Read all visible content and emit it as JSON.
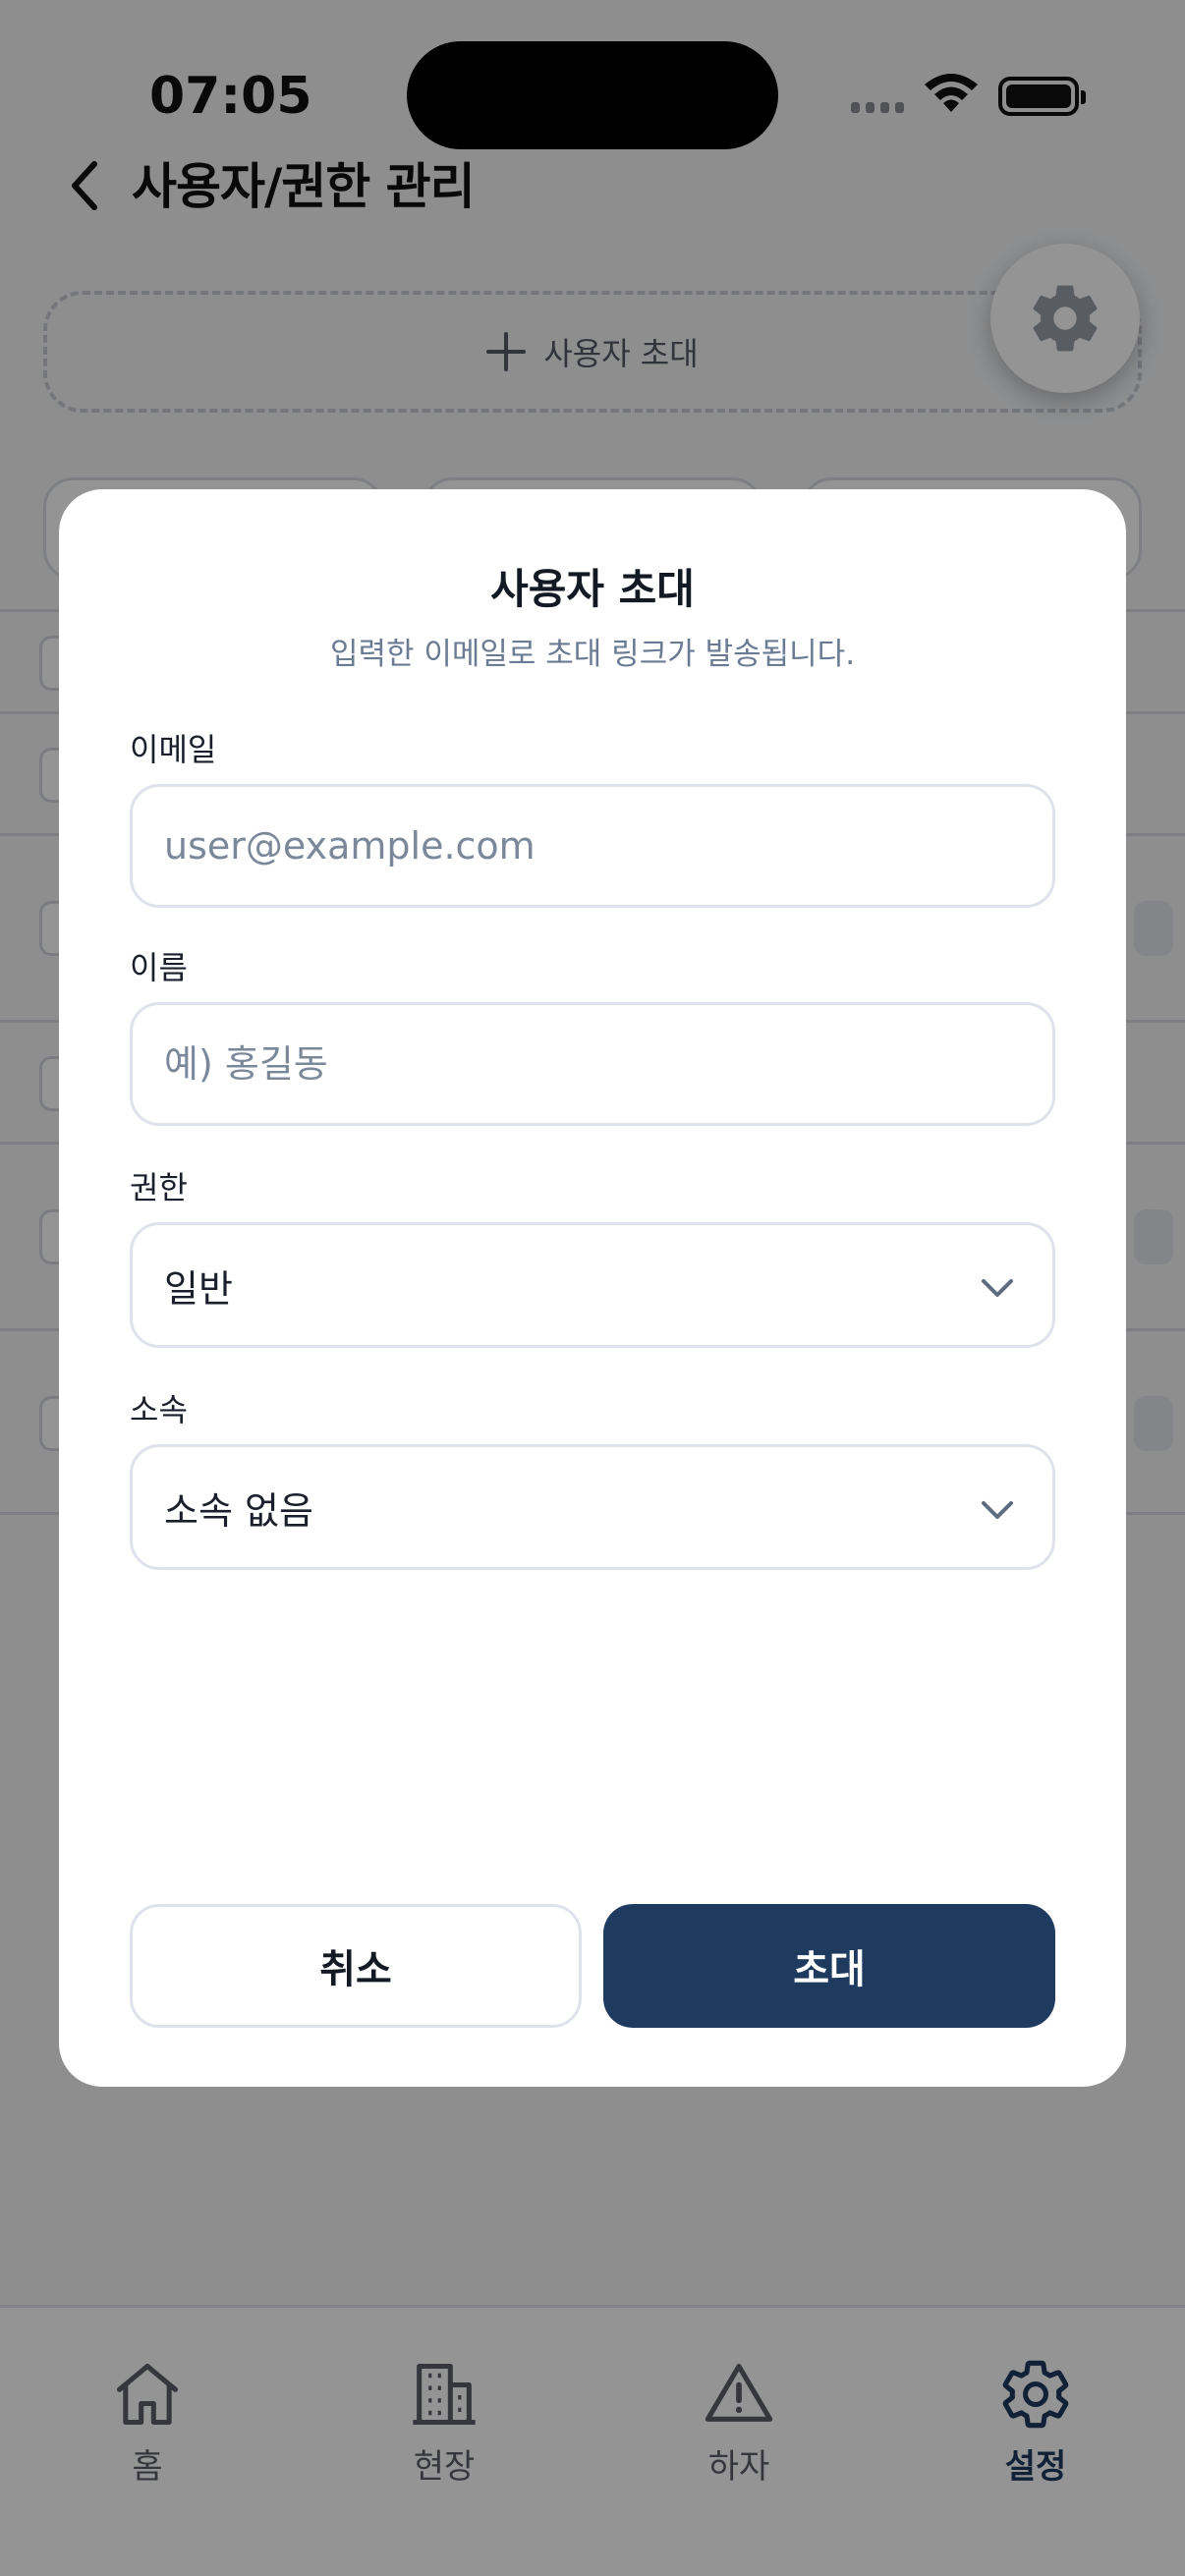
{
  "status_bar": {
    "time": "07:05"
  },
  "header": {
    "title": "사용자/권한 관리"
  },
  "invite_area": {
    "label": "사용자 초대"
  },
  "modal": {
    "title": "사용자 초대",
    "subtitle": "입력한 이메일로 초대 링크가 발송됩니다.",
    "email": {
      "label": "이메일",
      "placeholder": "user@example.com",
      "value": ""
    },
    "name": {
      "label": "이름",
      "placeholder": "예) 홍길동",
      "value": ""
    },
    "role": {
      "label": "권한",
      "selected": "일반"
    },
    "affiliation": {
      "label": "소속",
      "selected": "소속 없음"
    },
    "cancel_label": "취소",
    "invite_label": "초대"
  },
  "tabbar": {
    "items": [
      {
        "label": "홈",
        "icon": "home-icon",
        "active": false
      },
      {
        "label": "현장",
        "icon": "building-icon",
        "active": false
      },
      {
        "label": "하자",
        "icon": "warning-icon",
        "active": false
      },
      {
        "label": "설정",
        "icon": "gear-icon",
        "active": true
      }
    ]
  },
  "colors": {
    "primary": "#1f3a5f",
    "overlay": "rgba(0,0,0,0.42)",
    "subtitle": "#6a7b93"
  }
}
